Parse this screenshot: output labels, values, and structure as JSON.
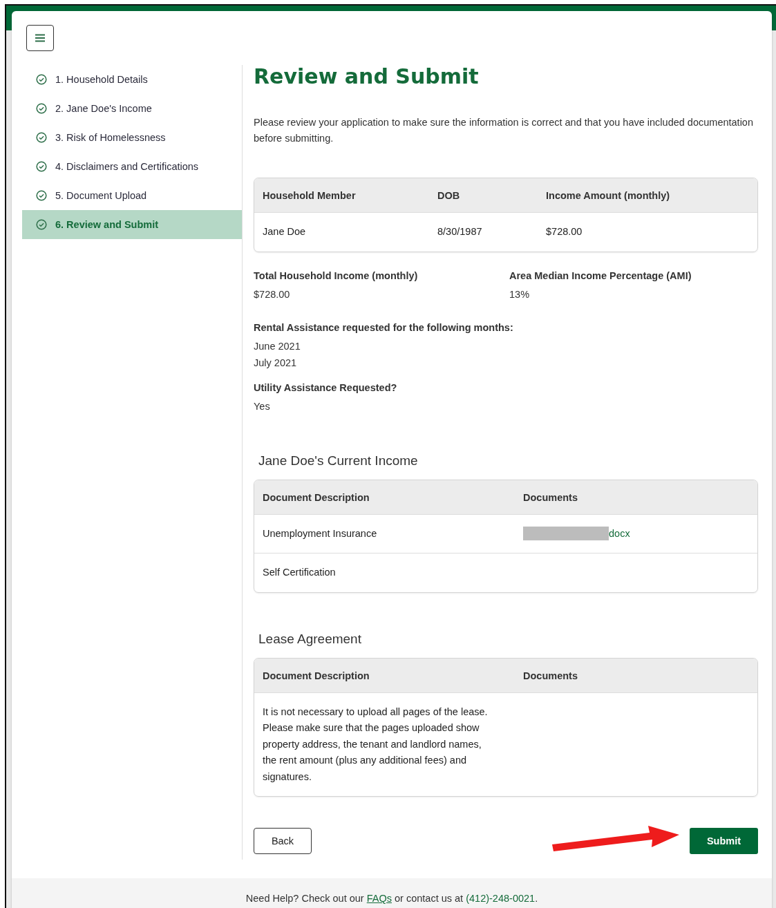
{
  "steps": [
    {
      "label": "1. Household Details",
      "completed": true,
      "selected": false
    },
    {
      "label": "2. Jane Doe's Income",
      "completed": true,
      "selected": false
    },
    {
      "label": "3. Risk of Homelessness",
      "completed": true,
      "selected": false
    },
    {
      "label": "4. Disclaimers and Certifications",
      "completed": true,
      "selected": false
    },
    {
      "label": "5. Document Upload",
      "completed": true,
      "selected": false
    },
    {
      "label": "6. Review and Submit",
      "completed": true,
      "selected": true
    }
  ],
  "title": "Review and Submit",
  "intro": "Please review your application to make sure the information is correct and that you have included documentation before submitting.",
  "household_table": {
    "columns": [
      "Household Member",
      "DOB",
      "Income Amount (monthly)"
    ],
    "rows": [
      [
        "Jane Doe",
        "8/30/1987",
        "$728.00"
      ]
    ]
  },
  "summary": [
    {
      "label": "Total Household Income (monthly)",
      "value": "$728.00"
    },
    {
      "label": "Area Median Income Percentage (AMI)",
      "value": "13%"
    }
  ],
  "rental_months": {
    "label": "Rental Assistance requested for the following months:",
    "values": [
      "June 2021",
      "July 2021"
    ]
  },
  "utility": {
    "label": "Utility Assistance Requested?",
    "value": "Yes"
  },
  "document_sections": [
    {
      "heading": "Jane Doe's Current Income",
      "columns": [
        "Document Description",
        "Documents"
      ],
      "rows": [
        {
          "description": "Unemployment Insurance",
          "document": "docx",
          "redacted": true
        },
        {
          "description": "Self Certification"
        }
      ]
    },
    {
      "heading": "Lease Agreement",
      "columns": [
        "Document Description",
        "Documents"
      ],
      "rows": [
        {
          "description": "It is not necessary to upload all pages of the lease. Please make sure that the pages uploaded show property address, the tenant and landlord names, the rent amount (plus any additional fees) and signatures."
        }
      ]
    }
  ],
  "buttons": {
    "back": "Back",
    "submit": "Submit"
  },
  "footer": {
    "text_1": "Need Help? Check out our ",
    "link": "FAQs",
    "text_2": " or contact us at ",
    "phone": "(412)-248-0021",
    "text_3": "."
  }
}
